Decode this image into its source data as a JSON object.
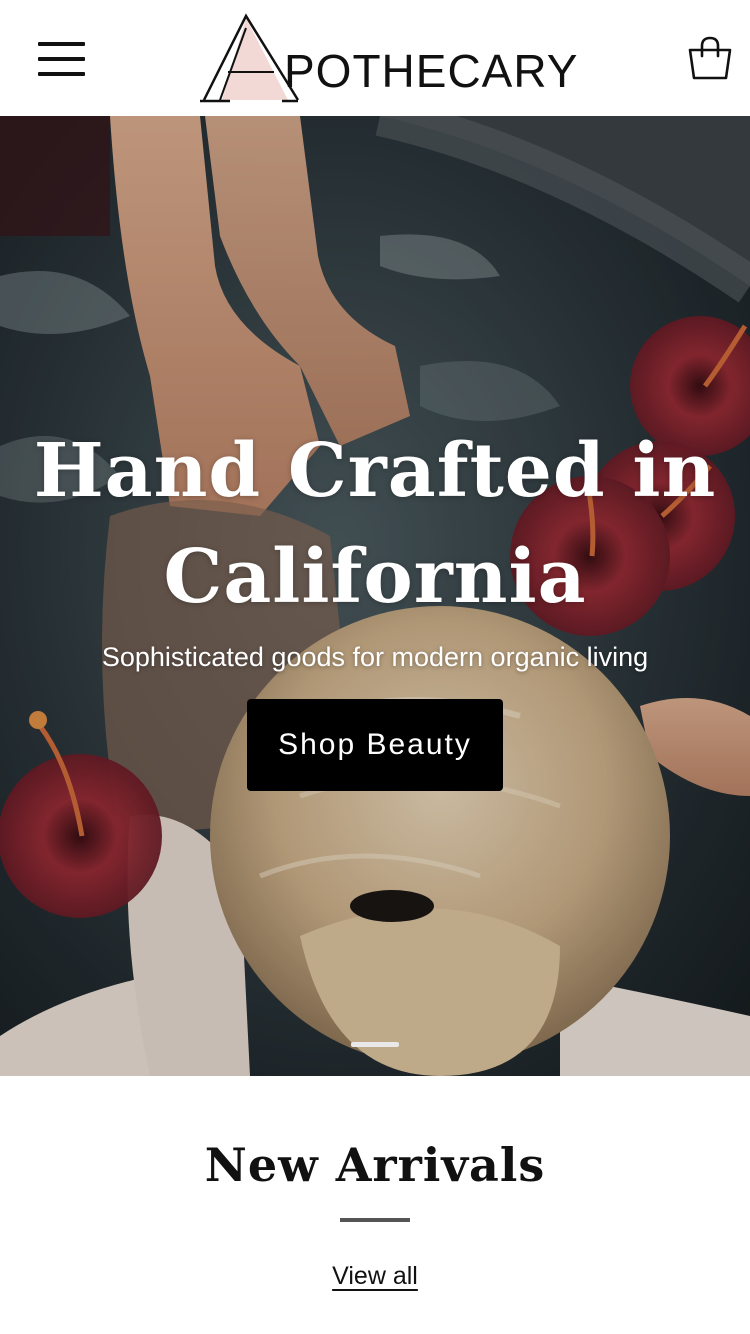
{
  "header": {
    "logo_text": "APOTHECARY",
    "logo_rest": "POTHECARY",
    "menu_icon": "hamburger-menu-icon",
    "cart_icon": "shopping-bag-icon"
  },
  "hero": {
    "title": "Hand Crafted in California",
    "subtitle": "Sophisticated goods for modern organic living",
    "button_label": "Shop Beauty",
    "slides_total": 1,
    "active_slide": 1
  },
  "new_arrivals": {
    "title": "New Arrivals",
    "view_all_label": "View all"
  },
  "colors": {
    "button_bg": "#000000",
    "button_text": "#ffffff",
    "logo_accent": "#f3d9d6"
  }
}
